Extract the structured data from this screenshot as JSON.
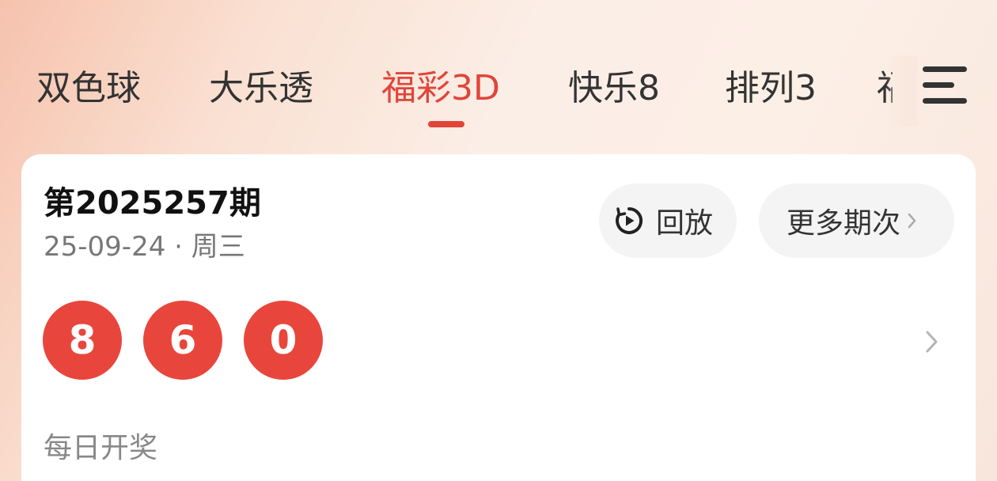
{
  "tabs": [
    {
      "label": "双色球"
    },
    {
      "label": "大乐透"
    },
    {
      "label": "福彩3D"
    },
    {
      "label": "快乐8"
    },
    {
      "label": "排列3"
    },
    {
      "label": "福"
    }
  ],
  "active_tab": "福彩3D",
  "colors": {
    "accent": "#e0453a",
    "ball": "#e8463c"
  },
  "icons": {
    "menu": "menu-icon",
    "replay": "replay-icon",
    "chevron": "chevron-right-icon"
  },
  "card": {
    "issue_title": "第2025257期",
    "issue_date": "25-09-24 · 周三",
    "replay_label": "回放",
    "more_label": "更多期次",
    "numbers": [
      "8",
      "6",
      "0"
    ],
    "draw_schedule": "每日开奖"
  }
}
